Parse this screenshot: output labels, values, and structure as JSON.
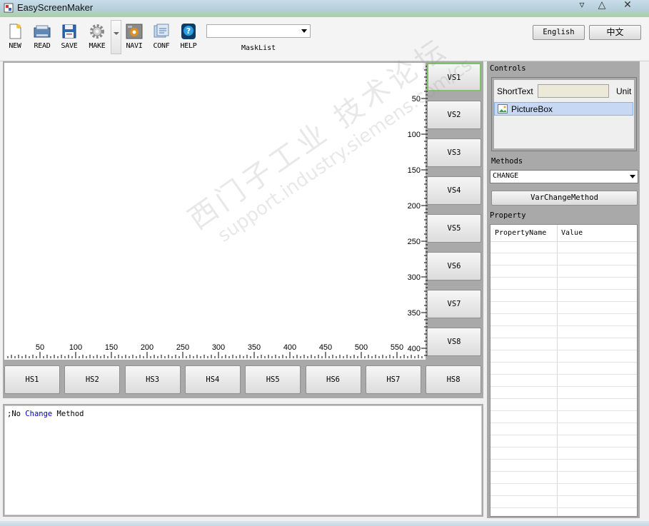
{
  "window": {
    "title": "EasyScreenMaker"
  },
  "toolbar": {
    "new": "NEW",
    "read": "READ",
    "save": "SAVE",
    "make": "MAKE",
    "navi": "NAVI",
    "conf": "CONF",
    "help": "HELP",
    "masklist_label": "MaskList",
    "masklist_value": "",
    "english": "English",
    "chinese": "中文"
  },
  "vertical_ruler": {
    "labels": [
      "50",
      "100",
      "150",
      "200",
      "250",
      "300",
      "350",
      "400"
    ]
  },
  "horizontal_ruler": {
    "labels": [
      "50",
      "100",
      "150",
      "200",
      "250",
      "300",
      "350",
      "400",
      "450",
      "500",
      "550"
    ]
  },
  "vs_buttons": [
    "VS1",
    "VS2",
    "VS3",
    "VS4",
    "VS5",
    "VS6",
    "VS7",
    "VS8"
  ],
  "hs_buttons": [
    "HS1",
    "HS2",
    "HS3",
    "HS4",
    "HS5",
    "HS6",
    "HS7",
    "HS8"
  ],
  "code": {
    "prefix": ";No ",
    "keyword": "Change",
    "suffix": " Method"
  },
  "panel": {
    "controls_label": "Controls",
    "shorttext_label": "ShortText",
    "shorttext_value": "",
    "unit_label": "Unit",
    "picturebox_label": "PictureBox",
    "methods_label": "Methods",
    "method_selected": "CHANGE",
    "var_change_button": "VarChangeMethod",
    "property_label": "Property",
    "col_name": "PropertyName",
    "col_value": "Value"
  },
  "watermark": {
    "line1": "西门子工业 技术论坛",
    "line2": "support.industry.siemens.com/cs"
  },
  "colors": {
    "accent_green": "#7ec26a",
    "code_keyword": "#0000c0",
    "selection": "#c6d8f3"
  }
}
